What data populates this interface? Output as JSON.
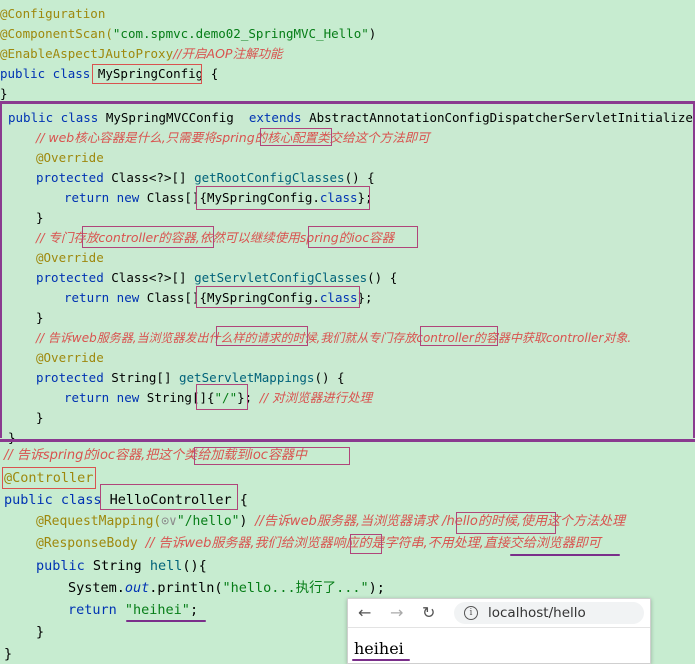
{
  "top": {
    "l1": "@Configuration",
    "l2a": "@ComponentScan(",
    "l2b": "\"com.spmvc.demo02_SpringMVC_Hello\"",
    "l2c": ")",
    "l3a": "@EnableAspectJAutoProxy",
    "l3b": "//开启AOP注解功能",
    "l4a": "public class ",
    "l4b": "MySpringConfig",
    "l4c": " {",
    "l5": "}"
  },
  "mid": {
    "m1a": "public class ",
    "m1b": "MySpringMVCConfig  ",
    "m1c": "extends ",
    "m1d": "AbstractAnnotationConfigDispatcherServletInitializer {",
    "m2": "// web核心容器是什么,只需要将spring的核心配置类交给这个方法即可",
    "m3": "@Override",
    "m4a": "protected ",
    "m4b": "Class<?>[] ",
    "m4c": "getRootConfigClasses",
    "m4d": "() {",
    "m5a": "return new ",
    "m5b": "Class[]{MySpringConfig.",
    "m5c": "class",
    "m5d": "};",
    "m6": "}",
    "m7": "// 专门存放controller的容器,依然可以继续使用spring的ioc容器",
    "m8": "@Override",
    "m9a": "protected ",
    "m9b": "Class<?>[] ",
    "m9c": "getServletConfigClasses",
    "m9d": "() {",
    "m10a": "return new ",
    "m10b": "Class[]{MySpringConfig.",
    "m10c": "class",
    "m10d": "};",
    "m11": "}",
    "m12": "// 告诉web服务器,当浏览器发出什么样的请求的时候,我们就从专门存放controller的容器中获取controller对象.",
    "m13": "@Override",
    "m14a": "protected ",
    "m14b": "String[] ",
    "m14c": "getServletMappings",
    "m14d": "() {",
    "m15a": "return new ",
    "m15b": "String[]{",
    "m15c": "\"/\"",
    "m15d": "}; ",
    "m15e": "// 对浏览器进行处理",
    "m16": "}",
    "m17": "}"
  },
  "bot": {
    "b1": "// 告诉spring的ioc容器,把这个类给加载到ioc容器中",
    "b2": "@Controller",
    "b3a": "public class ",
    "b3b": "HelloController",
    "b3c": " {",
    "b4a": "@RequestMapping(",
    "b4b": "⊙∨",
    "b4c": "\"/hello\"",
    "b4d": ") ",
    "b4e": "//告诉web服务器,当浏览器请求 /hello的时候,使用这个方法处理",
    "b5a": "@ResponseBody ",
    "b5b": "// 告诉web服务器,我们给浏览器响应的是字符串,不用处理,直接交给浏览器即可",
    "b6a": "public ",
    "b6b": "String ",
    "b6c": "hell",
    "b6d": "(){",
    "b7a": "System.",
    "b7b": "out",
    "b7c": ".println(",
    "b7d": "\"hello...执行了...\"",
    "b7e": ");",
    "b8a": "return ",
    "b8b": "\"heihei\"",
    "b8c": ";",
    "b9": "}",
    "b10": "}"
  },
  "browser": {
    "back": "←",
    "forward": "→",
    "reload": "↻",
    "info": "i",
    "url": "localhost/hello",
    "content": "heihei"
  }
}
